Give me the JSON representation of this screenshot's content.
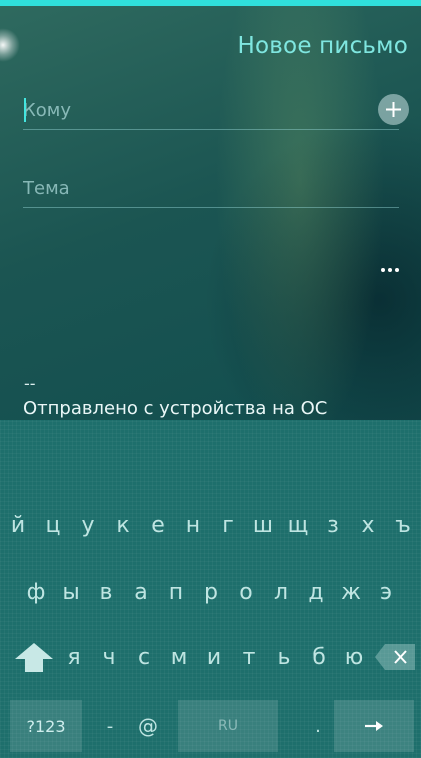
{
  "header": {
    "title": "Новое письмо"
  },
  "compose": {
    "to_placeholder": "Кому",
    "subject_placeholder": "Тема",
    "signature_dashes": "--",
    "signature_text": "Отправлено с устройства на ОС"
  },
  "keyboard": {
    "row1": [
      "й",
      "ц",
      "у",
      "к",
      "е",
      "н",
      "г",
      "ш",
      "щ",
      "з",
      "х",
      "ъ"
    ],
    "row2": [
      "ф",
      "ы",
      "в",
      "а",
      "п",
      "р",
      "о",
      "л",
      "д",
      "ж",
      "э"
    ],
    "row3": [
      "я",
      "ч",
      "с",
      "м",
      "и",
      "т",
      "ь",
      "б",
      "ю"
    ],
    "numbers_label": "?123",
    "dash_label": "-",
    "at_label": "@",
    "space_label": "RU",
    "dot_label": "."
  },
  "icons": {
    "add": "plus-icon",
    "more": "more-dots-icon",
    "shift": "shift-arrow-icon",
    "backspace": "backspace-icon",
    "enter": "enter-arrow-icon"
  },
  "colors": {
    "accent": "#2fe0dc",
    "title": "#7fe6e0",
    "keyboard_bg": "#1e6f6c"
  }
}
